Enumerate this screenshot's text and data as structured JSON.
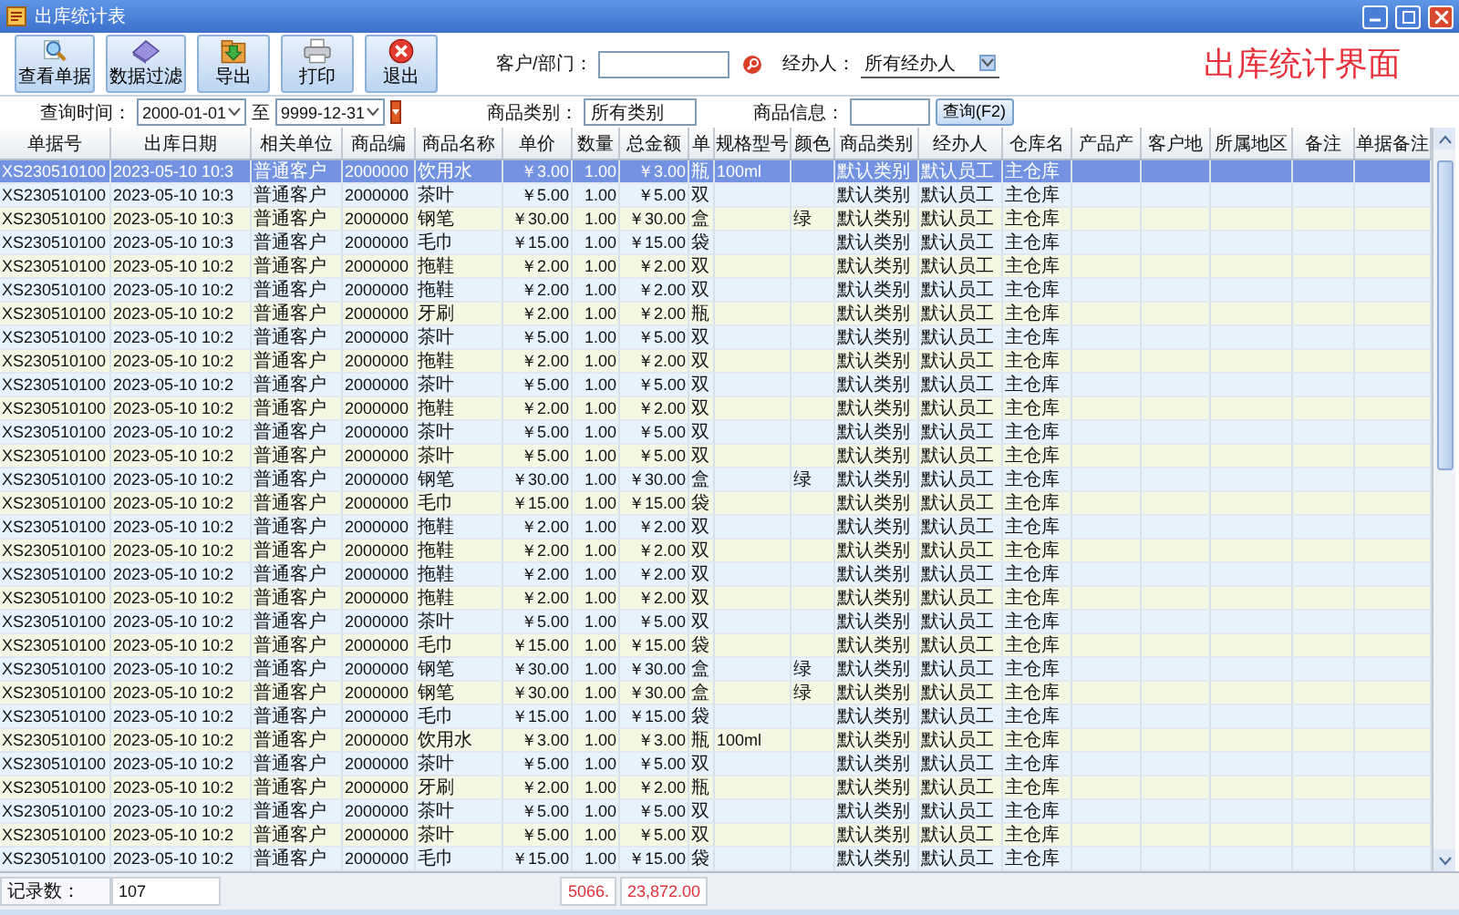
{
  "window": {
    "title": "出库统计表"
  },
  "toolbar": [
    {
      "label": "查看单据",
      "kind": "view"
    },
    {
      "label": "数据过滤",
      "kind": "filter"
    },
    {
      "label": "导出",
      "kind": "export"
    },
    {
      "label": "打印",
      "kind": "print"
    },
    {
      "label": "退出",
      "kind": "exit"
    }
  ],
  "filters": {
    "customer_label": "客户/部门：",
    "handler_label": "经办人：",
    "handler_value": "所有经办人",
    "date_label": "查询时间：",
    "date_from": "2000-01-01",
    "date_to_label": "至",
    "date_to": "9999-12-31",
    "category_label": "商品类别：",
    "category_value": "所有类别",
    "info_label": "商品信息：",
    "query_button": "查询(F2)"
  },
  "heading": "出库统计界面",
  "table": {
    "columns": [
      "单据号",
      "出库日期",
      "相关单位",
      "商品编",
      "商品名称",
      "单价",
      "数量",
      "总金额",
      "单",
      "规格型号",
      "颜色",
      "商品类别",
      "经办人",
      "仓库名",
      "产品产",
      "客户地",
      "所属地区",
      "备注",
      "单据备注"
    ],
    "rows": [
      {
        "doc_no": "XS230510100",
        "date": "2023-05-10 10:3",
        "partner": "普通客户",
        "code": "2000000",
        "name": "饮用水",
        "price": "￥3.00",
        "qty": "1.00",
        "total": "￥3.00",
        "unit": "瓶",
        "spec": "100ml",
        "category": "默认类别",
        "handler": "默认员工",
        "warehouse": "主仓库",
        "selected": true
      },
      {
        "doc_no": "XS230510100",
        "date": "2023-05-10 10:3",
        "partner": "普通客户",
        "code": "2000000",
        "name": "茶叶",
        "price": "￥5.00",
        "qty": "1.00",
        "total": "￥5.00",
        "unit": "双",
        "category": "默认类别",
        "handler": "默认员工",
        "warehouse": "主仓库",
        "selected": false
      },
      {
        "doc_no": "XS230510100",
        "date": "2023-05-10 10:3",
        "partner": "普通客户",
        "code": "2000000",
        "name": "钢笔",
        "price": "￥30.00",
        "qty": "1.00",
        "total": "￥30.00",
        "unit": "盒",
        "color_name": "绿",
        "category": "默认类别",
        "handler": "默认员工",
        "warehouse": "主仓库",
        "selected": false
      },
      {
        "doc_no": "XS230510100",
        "date": "2023-05-10 10:3",
        "partner": "普通客户",
        "code": "2000000",
        "name": "毛巾",
        "price": "￥15.00",
        "qty": "1.00",
        "total": "￥15.00",
        "unit": "袋",
        "category": "默认类别",
        "handler": "默认员工",
        "warehouse": "主仓库",
        "selected": false
      },
      {
        "doc_no": "XS230510100",
        "date": "2023-05-10 10:2",
        "partner": "普通客户",
        "code": "2000000",
        "name": "拖鞋",
        "price": "￥2.00",
        "qty": "1.00",
        "total": "￥2.00",
        "unit": "双",
        "category": "默认类别",
        "handler": "默认员工",
        "warehouse": "主仓库",
        "selected": false
      },
      {
        "doc_no": "XS230510100",
        "date": "2023-05-10 10:2",
        "partner": "普通客户",
        "code": "2000000",
        "name": "拖鞋",
        "price": "￥2.00",
        "qty": "1.00",
        "total": "￥2.00",
        "unit": "双",
        "category": "默认类别",
        "handler": "默认员工",
        "warehouse": "主仓库",
        "selected": false
      },
      {
        "doc_no": "XS230510100",
        "date": "2023-05-10 10:2",
        "partner": "普通客户",
        "code": "2000000",
        "name": "牙刷",
        "price": "￥2.00",
        "qty": "1.00",
        "total": "￥2.00",
        "unit": "瓶",
        "category": "默认类别",
        "handler": "默认员工",
        "warehouse": "主仓库",
        "selected": false
      },
      {
        "doc_no": "XS230510100",
        "date": "2023-05-10 10:2",
        "partner": "普通客户",
        "code": "2000000",
        "name": "茶叶",
        "price": "￥5.00",
        "qty": "1.00",
        "total": "￥5.00",
        "unit": "双",
        "category": "默认类别",
        "handler": "默认员工",
        "warehouse": "主仓库",
        "selected": false
      },
      {
        "doc_no": "XS230510100",
        "date": "2023-05-10 10:2",
        "partner": "普通客户",
        "code": "2000000",
        "name": "拖鞋",
        "price": "￥2.00",
        "qty": "1.00",
        "total": "￥2.00",
        "unit": "双",
        "category": "默认类别",
        "handler": "默认员工",
        "warehouse": "主仓库",
        "selected": false
      },
      {
        "doc_no": "XS230510100",
        "date": "2023-05-10 10:2",
        "partner": "普通客户",
        "code": "2000000",
        "name": "茶叶",
        "price": "￥5.00",
        "qty": "1.00",
        "total": "￥5.00",
        "unit": "双",
        "category": "默认类别",
        "handler": "默认员工",
        "warehouse": "主仓库",
        "selected": false
      },
      {
        "doc_no": "XS230510100",
        "date": "2023-05-10 10:2",
        "partner": "普通客户",
        "code": "2000000",
        "name": "拖鞋",
        "price": "￥2.00",
        "qty": "1.00",
        "total": "￥2.00",
        "unit": "双",
        "category": "默认类别",
        "handler": "默认员工",
        "warehouse": "主仓库",
        "selected": false
      },
      {
        "doc_no": "XS230510100",
        "date": "2023-05-10 10:2",
        "partner": "普通客户",
        "code": "2000000",
        "name": "茶叶",
        "price": "￥5.00",
        "qty": "1.00",
        "total": "￥5.00",
        "unit": "双",
        "category": "默认类别",
        "handler": "默认员工",
        "warehouse": "主仓库",
        "selected": false
      },
      {
        "doc_no": "XS230510100",
        "date": "2023-05-10 10:2",
        "partner": "普通客户",
        "code": "2000000",
        "name": "茶叶",
        "price": "￥5.00",
        "qty": "1.00",
        "total": "￥5.00",
        "unit": "双",
        "category": "默认类别",
        "handler": "默认员工",
        "warehouse": "主仓库",
        "selected": false
      },
      {
        "doc_no": "XS230510100",
        "date": "2023-05-10 10:2",
        "partner": "普通客户",
        "code": "2000000",
        "name": "钢笔",
        "price": "￥30.00",
        "qty": "1.00",
        "total": "￥30.00",
        "unit": "盒",
        "color_name": "绿",
        "category": "默认类别",
        "handler": "默认员工",
        "warehouse": "主仓库",
        "selected": false
      },
      {
        "doc_no": "XS230510100",
        "date": "2023-05-10 10:2",
        "partner": "普通客户",
        "code": "2000000",
        "name": "毛巾",
        "price": "￥15.00",
        "qty": "1.00",
        "total": "￥15.00",
        "unit": "袋",
        "category": "默认类别",
        "handler": "默认员工",
        "warehouse": "主仓库",
        "selected": false
      },
      {
        "doc_no": "XS230510100",
        "date": "2023-05-10 10:2",
        "partner": "普通客户",
        "code": "2000000",
        "name": "拖鞋",
        "price": "￥2.00",
        "qty": "1.00",
        "total": "￥2.00",
        "unit": "双",
        "category": "默认类别",
        "handler": "默认员工",
        "warehouse": "主仓库",
        "selected": false
      },
      {
        "doc_no": "XS230510100",
        "date": "2023-05-10 10:2",
        "partner": "普通客户",
        "code": "2000000",
        "name": "拖鞋",
        "price": "￥2.00",
        "qty": "1.00",
        "total": "￥2.00",
        "unit": "双",
        "category": "默认类别",
        "handler": "默认员工",
        "warehouse": "主仓库",
        "selected": false
      },
      {
        "doc_no": "XS230510100",
        "date": "2023-05-10 10:2",
        "partner": "普通客户",
        "code": "2000000",
        "name": "拖鞋",
        "price": "￥2.00",
        "qty": "1.00",
        "total": "￥2.00",
        "unit": "双",
        "category": "默认类别",
        "handler": "默认员工",
        "warehouse": "主仓库",
        "selected": false
      },
      {
        "doc_no": "XS230510100",
        "date": "2023-05-10 10:2",
        "partner": "普通客户",
        "code": "2000000",
        "name": "拖鞋",
        "price": "￥2.00",
        "qty": "1.00",
        "total": "￥2.00",
        "unit": "双",
        "category": "默认类别",
        "handler": "默认员工",
        "warehouse": "主仓库",
        "selected": false
      },
      {
        "doc_no": "XS230510100",
        "date": "2023-05-10 10:2",
        "partner": "普通客户",
        "code": "2000000",
        "name": "茶叶",
        "price": "￥5.00",
        "qty": "1.00",
        "total": "￥5.00",
        "unit": "双",
        "category": "默认类别",
        "handler": "默认员工",
        "warehouse": "主仓库",
        "selected": false
      },
      {
        "doc_no": "XS230510100",
        "date": "2023-05-10 10:2",
        "partner": "普通客户",
        "code": "2000000",
        "name": "毛巾",
        "price": "￥15.00",
        "qty": "1.00",
        "total": "￥15.00",
        "unit": "袋",
        "category": "默认类别",
        "handler": "默认员工",
        "warehouse": "主仓库",
        "selected": false
      },
      {
        "doc_no": "XS230510100",
        "date": "2023-05-10 10:2",
        "partner": "普通客户",
        "code": "2000000",
        "name": "钢笔",
        "price": "￥30.00",
        "qty": "1.00",
        "total": "￥30.00",
        "unit": "盒",
        "color_name": "绿",
        "category": "默认类别",
        "handler": "默认员工",
        "warehouse": "主仓库",
        "selected": false
      },
      {
        "doc_no": "XS230510100",
        "date": "2023-05-10 10:2",
        "partner": "普通客户",
        "code": "2000000",
        "name": "钢笔",
        "price": "￥30.00",
        "qty": "1.00",
        "total": "￥30.00",
        "unit": "盒",
        "color_name": "绿",
        "category": "默认类别",
        "handler": "默认员工",
        "warehouse": "主仓库",
        "selected": false
      },
      {
        "doc_no": "XS230510100",
        "date": "2023-05-10 10:2",
        "partner": "普通客户",
        "code": "2000000",
        "name": "毛巾",
        "price": "￥15.00",
        "qty": "1.00",
        "total": "￥15.00",
        "unit": "袋",
        "category": "默认类别",
        "handler": "默认员工",
        "warehouse": "主仓库",
        "selected": false
      },
      {
        "doc_no": "XS230510100",
        "date": "2023-05-10 10:2",
        "partner": "普通客户",
        "code": "2000000",
        "name": "饮用水",
        "price": "￥3.00",
        "qty": "1.00",
        "total": "￥3.00",
        "unit": "瓶",
        "spec": "100ml",
        "category": "默认类别",
        "handler": "默认员工",
        "warehouse": "主仓库",
        "selected": false
      },
      {
        "doc_no": "XS230510100",
        "date": "2023-05-10 10:2",
        "partner": "普通客户",
        "code": "2000000",
        "name": "茶叶",
        "price": "￥5.00",
        "qty": "1.00",
        "total": "￥5.00",
        "unit": "双",
        "category": "默认类别",
        "handler": "默认员工",
        "warehouse": "主仓库",
        "selected": false
      },
      {
        "doc_no": "XS230510100",
        "date": "2023-05-10 10:2",
        "partner": "普通客户",
        "code": "2000000",
        "name": "牙刷",
        "price": "￥2.00",
        "qty": "1.00",
        "total": "￥2.00",
        "unit": "瓶",
        "category": "默认类别",
        "handler": "默认员工",
        "warehouse": "主仓库",
        "selected": false
      },
      {
        "doc_no": "XS230510100",
        "date": "2023-05-10 10:2",
        "partner": "普通客户",
        "code": "2000000",
        "name": "茶叶",
        "price": "￥5.00",
        "qty": "1.00",
        "total": "￥5.00",
        "unit": "双",
        "category": "默认类别",
        "handler": "默认员工",
        "warehouse": "主仓库",
        "selected": false
      },
      {
        "doc_no": "XS230510100",
        "date": "2023-05-10 10:2",
        "partner": "普通客户",
        "code": "2000000",
        "name": "茶叶",
        "price": "￥5.00",
        "qty": "1.00",
        "total": "￥5.00",
        "unit": "双",
        "category": "默认类别",
        "handler": "默认员工",
        "warehouse": "主仓库",
        "selected": false
      },
      {
        "doc_no": "XS230510100",
        "date": "2023-05-10 10:2",
        "partner": "普通客户",
        "code": "2000000",
        "name": "毛巾",
        "price": "￥15.00",
        "qty": "1.00",
        "total": "￥15.00",
        "unit": "袋",
        "category": "默认类别",
        "handler": "默认员工",
        "warehouse": "主仓库",
        "selected": false
      }
    ]
  },
  "footer": {
    "count_label": "记录数：",
    "count": "107",
    "qty_total": "5066.",
    "amount_total": "23,872.00"
  }
}
